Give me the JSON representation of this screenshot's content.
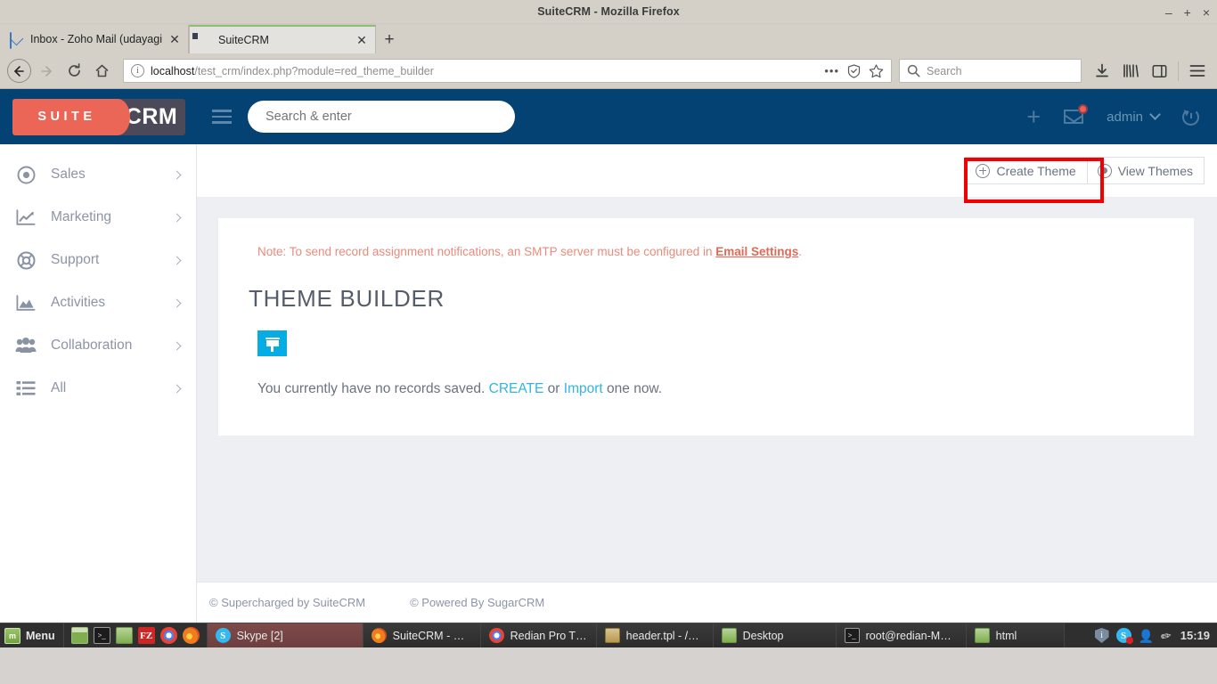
{
  "browser": {
    "window_title": "SuiteCRM - Mozilla Firefox",
    "window_buttons": {
      "minimize": "–",
      "maximize": "+",
      "close": "×"
    },
    "tabs": [
      {
        "title": "Inbox - Zoho Mail (udayagiri.n",
        "favicon": "zoho-mail-icon",
        "active": false,
        "close": "✕"
      },
      {
        "title": "SuiteCRM",
        "favicon": "suitecrm-icon",
        "active": true,
        "close": "✕"
      }
    ],
    "new_tab_label": "+",
    "toolbar": {
      "back": "←",
      "forward": "→",
      "reload": "↻",
      "home": "⌂",
      "url_host": "localhost",
      "url_path": "/test_crm/index.php?module=red_theme_builder",
      "page_actions_label": "•••",
      "search_placeholder": "Search",
      "search_value": "",
      "downloads": "⤓",
      "library": "|||\\",
      "sidebars": "▤",
      "menu": "☰"
    }
  },
  "crm": {
    "logo": {
      "left_text": "SUITE",
      "right_text": "CRM",
      "left_color": "#ec6657",
      "right_color": "#4c4a58"
    },
    "navbar": {
      "background": "#034273",
      "search_placeholder": "Search & enter",
      "search_value": "",
      "quick_create_label": "+",
      "notification_count": "",
      "user_name": "admin"
    },
    "sidebar": {
      "items": [
        {
          "label": "Sales",
          "icon": "target-icon"
        },
        {
          "label": "Marketing",
          "icon": "chart-line-icon"
        },
        {
          "label": "Support",
          "icon": "lifebuoy-icon"
        },
        {
          "label": "Activities",
          "icon": "area-chart-icon"
        },
        {
          "label": "Collaboration",
          "icon": "users-icon"
        },
        {
          "label": "All",
          "icon": "list-icon"
        }
      ]
    },
    "action_bar": {
      "buttons": [
        {
          "label": "Create Theme",
          "icon": "circle-plus-icon",
          "highlighted": true
        },
        {
          "label": "View Themes",
          "icon": "eye-icon",
          "highlighted": false
        }
      ],
      "highlight_color": "#f00000"
    },
    "panel": {
      "note_prefix": "Note: To send record assignment notifications, an SMTP server must be configured in ",
      "note_link": "Email Settings",
      "note_suffix": ".",
      "note_color": "#e98b7c",
      "title": "THEME BUILDER",
      "filter_icon": "funnel-icon",
      "filter_color": "#06ade4",
      "empty_prefix": "You currently have no records saved. ",
      "empty_create_link": "CREATE",
      "empty_or": " or ",
      "empty_import_link": "Import",
      "empty_suffix": " one now.",
      "link_color": "#32b5e3"
    },
    "footer": {
      "supercharged": "© Supercharged by SuiteCRM",
      "powered": "© Powered By SugarCRM"
    }
  },
  "taskbar": {
    "menu_label": "Menu",
    "menu_icon": "linux-mint-icon",
    "quick_launch": [
      {
        "icon": "show-desktop-icon"
      },
      {
        "icon": "terminal-icon",
        "glyph": ">_"
      },
      {
        "icon": "file-manager-icon"
      },
      {
        "icon": "filezilla-icon",
        "glyph": "FZ"
      },
      {
        "icon": "chrome-icon"
      },
      {
        "icon": "firefox-icon"
      }
    ],
    "windows": [
      {
        "label": "Skype [2]",
        "icon": "skype-icon",
        "glyph": "S",
        "active": true
      },
      {
        "label": "SuiteCRM - Mozil...",
        "icon": "firefox-icon"
      },
      {
        "label": "Redian Pro Them...",
        "icon": "chrome-icon"
      },
      {
        "label": "header.tpl - /hom...",
        "icon": "gedit-icon"
      },
      {
        "label": "Desktop",
        "icon": "folder-icon"
      },
      {
        "label": "root@redian-MS-...",
        "icon": "terminal-icon",
        "glyph": ">_"
      },
      {
        "label": "html",
        "icon": "folder-icon"
      }
    ],
    "tray": [
      {
        "icon": "shield-icon",
        "glyph": "i"
      },
      {
        "icon": "skype-tray-icon",
        "glyph": "S"
      },
      {
        "icon": "user-icon",
        "glyph": "👤"
      },
      {
        "icon": "pencil-icon",
        "glyph": "✒"
      }
    ],
    "clock": "15:19"
  }
}
